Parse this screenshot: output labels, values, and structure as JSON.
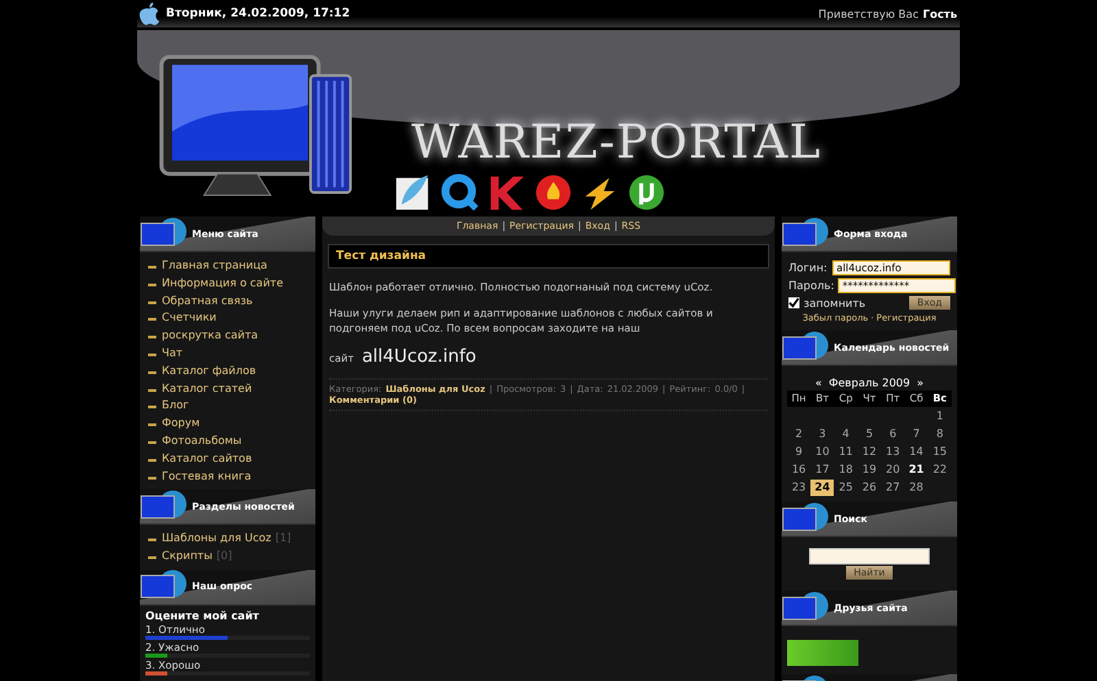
{
  "top_bar": {
    "date": "Вторник, 24.02.2009, 17:12",
    "greeting": "Приветствую Вас",
    "user": "Гость"
  },
  "header": {
    "logo": "WAREZ-PORTAL"
  },
  "nav": {
    "separator": "|",
    "links": [
      "Главная",
      "Регистрация",
      "Вход",
      "RSS"
    ]
  },
  "left": {
    "menu_title": "Меню сайта",
    "menu": [
      "Главная страница",
      "Информация о сайте",
      "Обратная связь",
      "Счетчики",
      "роскрутка сайта",
      "Чат",
      "Каталог файлов",
      "Каталог статей",
      "Блог",
      "Форум",
      "Фотоальбомы",
      "Каталог сайтов",
      "Гостевая книга"
    ],
    "sections_title": "Разделы новостей",
    "sections": [
      {
        "name": "Шаблоны для Ucoz",
        "count": "[1]"
      },
      {
        "name": "Скрипты",
        "count": "[0]"
      }
    ],
    "poll_title": "Наш опрос",
    "poll": {
      "question": "Оцените мой сайт",
      "options": [
        {
          "label": "1. Отлично",
          "level": 0.5,
          "color": "#1f3fd0"
        },
        {
          "label": "2. Ужасно",
          "level": 0.13,
          "color": "#1a9a1a"
        },
        {
          "label": "3. Хорошо",
          "level": 0.13,
          "color": "#d05030"
        }
      ]
    }
  },
  "post": {
    "title": "Тест дизайна",
    "paragraphs": [
      "Шаблон работает отлично. Полностью подогнаный под систему uCoz.",
      "Наши улуги делаем рип и адаптирование шаблонов с любых сайтов и подгоняем под uCoz. По всем вопросам заходите на наш"
    ],
    "site_prefix": "сайт",
    "meta_separator": "|",
    "site": "all4Ucoz.info",
    "meta": [
      {
        "label": "Категория:",
        "value": "Шаблоны для Ucoz",
        "kind": "link"
      },
      {
        "label": "Просмотров:",
        "value": "3",
        "kind": "plain"
      },
      {
        "label": "Дата:",
        "value": "21.02.2009",
        "kind": "plain"
      },
      {
        "label": "Рейтинг:",
        "value": "0.0/0",
        "kind": "plain"
      }
    ],
    "comments": "Комментарии (0)"
  },
  "right": {
    "login_title": "Форма входа",
    "login": {
      "login_label": "Логин:",
      "login_value": "all4ucoz.info",
      "password_label": "Пароль:",
      "password_value": "*************",
      "remember": "запомнить",
      "remember_checked": true,
      "submit": "Вход",
      "forgot": "Забыл пароль",
      "links_separator": "·",
      "register": "Регистрация"
    },
    "calendar_title": "Календарь новостей",
    "calendar": {
      "prev": "«",
      "month": "Февраль 2009",
      "next": "»",
      "weekdays": [
        {
          "label": "Пн",
          "weekend": false
        },
        {
          "label": "Вт",
          "weekend": false
        },
        {
          "label": "Ср",
          "weekend": false
        },
        {
          "label": "Чт",
          "weekend": false
        },
        {
          "label": "Пт",
          "weekend": false
        },
        {
          "label": "Сб",
          "weekend": false
        },
        {
          "label": "Вс",
          "weekend": true
        }
      ],
      "weeks": [
        [
          {
            "kind": "blank"
          },
          {
            "kind": "blank"
          },
          {
            "kind": "blank"
          },
          {
            "kind": "blank"
          },
          {
            "kind": "blank"
          },
          {
            "kind": "blank"
          },
          {
            "kind": "day",
            "day": "1"
          }
        ],
        [
          {
            "kind": "day",
            "day": "2"
          },
          {
            "kind": "day",
            "day": "3"
          },
          {
            "kind": "day",
            "day": "4"
          },
          {
            "kind": "day",
            "day": "5"
          },
          {
            "kind": "day",
            "day": "6"
          },
          {
            "kind": "day",
            "day": "7"
          },
          {
            "kind": "day",
            "day": "8"
          }
        ],
        [
          {
            "kind": "day",
            "day": "9"
          },
          {
            "kind": "day",
            "day": "10"
          },
          {
            "kind": "day",
            "day": "11"
          },
          {
            "kind": "day",
            "day": "12"
          },
          {
            "kind": "day",
            "day": "13"
          },
          {
            "kind": "day",
            "day": "14"
          },
          {
            "kind": "day",
            "day": "15"
          }
        ],
        [
          {
            "kind": "day",
            "day": "16"
          },
          {
            "kind": "day",
            "day": "17"
          },
          {
            "kind": "day",
            "day": "18"
          },
          {
            "kind": "day",
            "day": "19"
          },
          {
            "kind": "day",
            "day": "20"
          },
          {
            "kind": "news",
            "day": "21"
          },
          {
            "kind": "day",
            "day": "22"
          }
        ],
        [
          {
            "kind": "day",
            "day": "23"
          },
          {
            "kind": "today",
            "day": "24"
          },
          {
            "kind": "day",
            "day": "25"
          },
          {
            "kind": "day",
            "day": "26"
          },
          {
            "kind": "day",
            "day": "27"
          },
          {
            "kind": "day",
            "day": "28"
          },
          {
            "kind": "blank"
          }
        ]
      ]
    },
    "search_title": "Поиск",
    "search_button": "Найти",
    "friends_title": "Друзья сайта"
  }
}
